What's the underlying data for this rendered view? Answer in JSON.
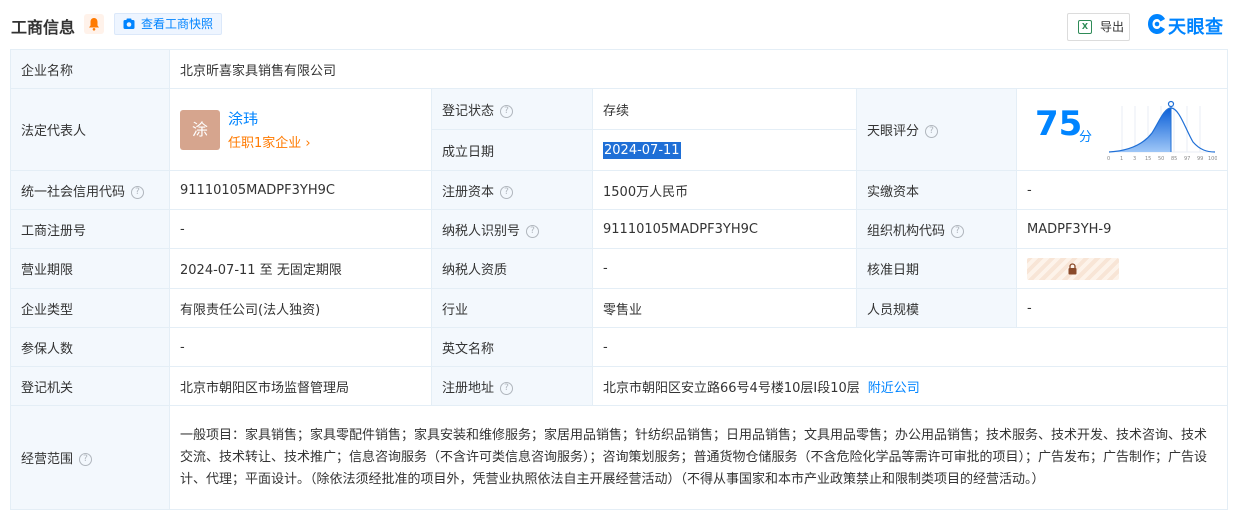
{
  "header": {
    "title": "工商信息",
    "snapshot_label": "查看工商快照",
    "export_label": "导出",
    "logo_text": "天眼查",
    "accent_color": "#0084ff"
  },
  "rows": {
    "company_name": {
      "label": "企业名称",
      "value": "北京昕喜家具销售有限公司"
    },
    "legal_rep": {
      "label": "法定代表人",
      "avatar": "涂",
      "name": "涂玮",
      "link": "任职1家企业",
      "link_arrow": "›"
    },
    "reg_status": {
      "label": "登记状态",
      "value": "存续"
    },
    "est_date": {
      "label": "成立日期",
      "value": "2024-07-11"
    },
    "score": {
      "label": "天眼评分",
      "value": "75",
      "unit": "分",
      "axis_ticks": [
        "0",
        "1",
        "3",
        "15",
        "50",
        "85",
        "97",
        "99",
        "100"
      ]
    },
    "credit_code": {
      "label": "统一社会信用代码",
      "value": "91110105MADPF3YH9C"
    },
    "reg_capital": {
      "label": "注册资本",
      "value": "1500万人民币"
    },
    "paid_capital": {
      "label": "实缴资本",
      "value": "-"
    },
    "reg_number": {
      "label": "工商注册号",
      "value": "-"
    },
    "taxpayer_id": {
      "label": "纳税人识别号",
      "value": "91110105MADPF3YH9C"
    },
    "org_code": {
      "label": "组织机构代码",
      "value": "MADPF3YH-9"
    },
    "biz_term": {
      "label": "营业期限",
      "value": "2024-07-11 至 无固定期限"
    },
    "taxpayer_qual": {
      "label": "纳税人资质",
      "value": "-"
    },
    "approval_date": {
      "label": "核准日期"
    },
    "company_type": {
      "label": "企业类型",
      "value": "有限责任公司(法人独资)"
    },
    "industry": {
      "label": "行业",
      "value": "零售业"
    },
    "staff_size": {
      "label": "人员规模",
      "value": "-"
    },
    "insured": {
      "label": "参保人数",
      "value": "-"
    },
    "english_name": {
      "label": "英文名称",
      "value": "-"
    },
    "reg_authority": {
      "label": "登记机关",
      "value": "北京市朝阳区市场监督管理局"
    },
    "reg_address": {
      "label": "注册地址",
      "value": "北京市朝阳区安立路66号4号楼10层I段10层",
      "link": "附近公司"
    },
    "biz_scope": {
      "label": "经营范围",
      "value": "一般项目：家具销售；家具零配件销售；家具安装和维修服务；家居用品销售；针纺织品销售；日用品销售；文具用品零售；办公用品销售；技术服务、技术开发、技术咨询、技术交流、技术转让、技术推广；信息咨询服务（不含许可类信息咨询服务）；咨询策划服务；普通货物仓储服务（不含危险化学品等需许可审批的项目）；广告发布；广告制作；广告设计、代理；平面设计。（除依法须经批准的项目外，凭营业执照依法自主开展经营活动）（不得从事国家和本市产业政策禁止和限制类项目的经营活动。）"
    }
  }
}
